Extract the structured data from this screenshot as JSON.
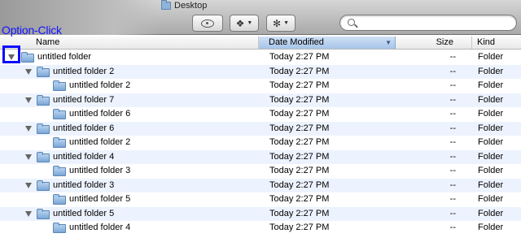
{
  "window": {
    "title": "Desktop"
  },
  "toolbar": {
    "buttons": [
      {
        "icon": "eye-icon"
      },
      {
        "icon": "dropbox-icon"
      },
      {
        "icon": "gear-icon"
      }
    ],
    "search": {
      "value": "",
      "placeholder": ""
    }
  },
  "annotation": {
    "label": "Option-Click",
    "color": "#0a0aff"
  },
  "columns": {
    "name": "Name",
    "date": "Date Modified",
    "size": "Size",
    "kind": "Kind"
  },
  "rows": [
    {
      "name": "untitled folder",
      "date": "Today 2:27 PM",
      "size": "--",
      "kind": "Folder"
    },
    {
      "name": "untitled folder 2",
      "date": "Today 2:27 PM",
      "size": "--",
      "kind": "Folder"
    },
    {
      "name": "untitled folder 2",
      "date": "Today 2:27 PM",
      "size": "--",
      "kind": "Folder"
    },
    {
      "name": "untitled folder 7",
      "date": "Today 2:27 PM",
      "size": "--",
      "kind": "Folder"
    },
    {
      "name": "untitled folder 6",
      "date": "Today 2:27 PM",
      "size": "--",
      "kind": "Folder"
    },
    {
      "name": "untitled folder 6",
      "date": "Today 2:27 PM",
      "size": "--",
      "kind": "Folder"
    },
    {
      "name": "untitled folder 2",
      "date": "Today 2:27 PM",
      "size": "--",
      "kind": "Folder"
    },
    {
      "name": "untitled folder 4",
      "date": "Today 2:27 PM",
      "size": "--",
      "kind": "Folder"
    },
    {
      "name": "untitled folder 3",
      "date": "Today 2:27 PM",
      "size": "--",
      "kind": "Folder"
    },
    {
      "name": "untitled folder 3",
      "date": "Today 2:27 PM",
      "size": "--",
      "kind": "Folder"
    },
    {
      "name": "untitled folder 5",
      "date": "Today 2:27 PM",
      "size": "--",
      "kind": "Folder"
    },
    {
      "name": "untitled folder 5",
      "date": "Today 2:27 PM",
      "size": "--",
      "kind": "Folder"
    },
    {
      "name": "untitled folder 4",
      "date": "Today 2:27 PM",
      "size": "--",
      "kind": "Folder"
    }
  ]
}
